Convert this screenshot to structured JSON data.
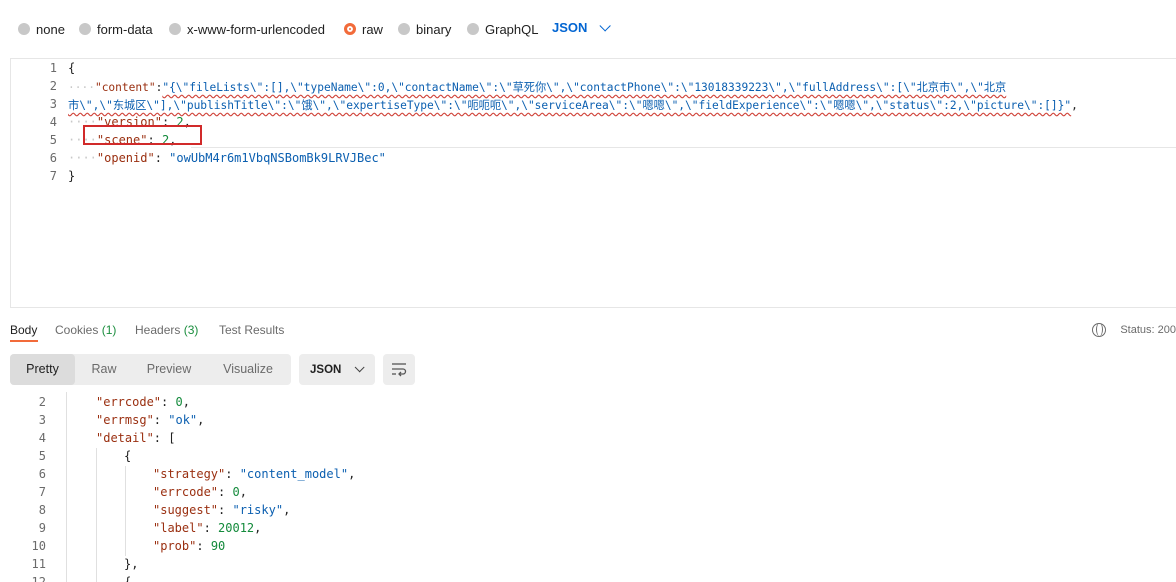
{
  "body_types": [
    "none",
    "form-data",
    "x-www-form-urlencoded",
    "raw",
    "binary",
    "GraphQL"
  ],
  "selected_body_type": "raw",
  "format": "JSON",
  "request": {
    "line_numbers": [
      "1",
      "2",
      "3",
      "4",
      "5",
      "6",
      "7"
    ],
    "brace_open": "{",
    "brace_close": "}",
    "content_key": "\"content\"",
    "content_value_part1": "\"{\\\"fileLists\\\":[],\\\"typeName\\\":0,\\\"contactName\\\":\\\"草死你\\\",\\\"contactPhone\\\":\\\"13018339223\\\",\\\"fullAddress\\\":[\\\"北京市\\\",\\\"北京",
    "content_value_part2": "市\\\",\\\"东城区\\\"],\\\"publishTitle\\\":\\\"饿\\\",\\\"expertiseType\\\":\\\"呃呃呃\\\",\\\"serviceArea\\\":\\\"嗯嗯\\\",\\\"fieldExperience\\\":\\\"嗯嗯\\\",\\\"status\\\":2,\\\"picture\\\":[]}\"",
    "version_key": "\"version\"",
    "version_value": "2",
    "scene_key": "\"scene\"",
    "scene_value": "2",
    "openid_key": "\"openid\"",
    "openid_value": "\"owUbM4r6m1VbqNSBomBk9LRVJBec\""
  },
  "response_tabs": {
    "body": "Body",
    "cookies": "Cookies",
    "cookies_count": "(1)",
    "headers": "Headers",
    "headers_count": "(3)",
    "test_results": "Test Results"
  },
  "status_text": "Status: 200",
  "view_modes": [
    "Pretty",
    "Raw",
    "Preview",
    "Visualize"
  ],
  "selected_view_mode": "Pretty",
  "response_format": "JSON",
  "response": {
    "line_numbers": [
      "2",
      "3",
      "4",
      "5",
      "6",
      "7",
      "8",
      "9",
      "10",
      "11",
      "12"
    ],
    "errcode_key": "\"errcode\"",
    "errcode_value": "0",
    "errmsg_key": "\"errmsg\"",
    "errmsg_value": "\"ok\"",
    "detail_key": "\"detail\"",
    "bracket_open": "[",
    "obj_open": "{",
    "strategy_key": "\"strategy\"",
    "strategy_value": "\"content_model\"",
    "d_errcode_key": "\"errcode\"",
    "d_errcode_value": "0",
    "suggest_key": "\"suggest\"",
    "suggest_value": "\"risky\"",
    "label_key": "\"label\"",
    "label_value": "20012",
    "prob_key": "\"prob\"",
    "prob_value": "90",
    "obj_close": "},",
    "next_obj_open": "{"
  },
  "colors": {
    "accent": "#f26b3a",
    "link_blue": "#0265d2",
    "key_red": "#9a2f10",
    "string_blue": "#0b5fb0",
    "number_green": "#138a3b",
    "highlight_box": "#d12a2a"
  }
}
